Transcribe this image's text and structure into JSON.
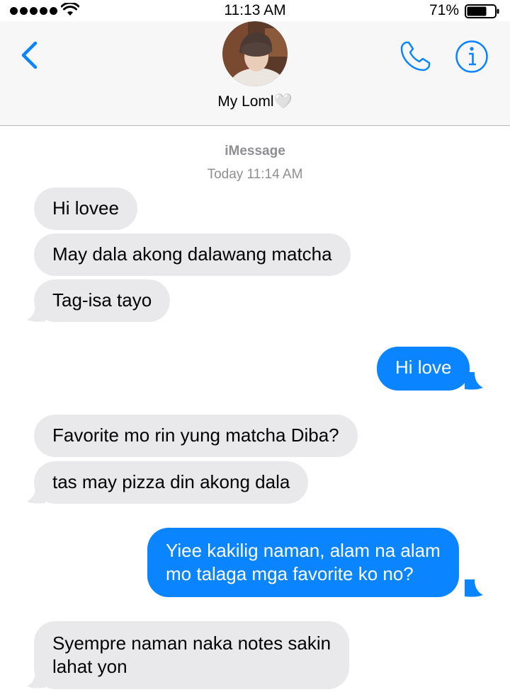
{
  "status_bar": {
    "time": "11:13 AM",
    "battery_percent": "71%",
    "battery_level": 0.71,
    "signal_bars": 5,
    "wifi_icon": "wifi-icon"
  },
  "header": {
    "contact_name": "My Loml🤍",
    "back_icon": "chevron-left-icon",
    "call_icon": "phone-icon",
    "info_icon": "info-icon",
    "accent_color": "#0a84ff"
  },
  "thread": {
    "service_label": "iMessage",
    "timestamp": "Today 11:14 AM",
    "messages": [
      {
        "direction": "incoming",
        "text": "Hi lovee"
      },
      {
        "direction": "incoming",
        "text": "May dala akong dalawang matcha"
      },
      {
        "direction": "incoming",
        "text": "Tag-isa tayo"
      },
      {
        "direction": "outgoing",
        "text": "Hi love"
      },
      {
        "direction": "incoming",
        "text": "Favorite mo rin yung matcha Diba?"
      },
      {
        "direction": "incoming",
        "text": "tas may pizza din akong dala"
      },
      {
        "direction": "outgoing",
        "text": [
          "Yiee kakilig naman, alam na alam",
          "mo talaga mga favorite ko no?"
        ]
      },
      {
        "direction": "incoming",
        "text": [
          "Syempre naman naka notes sakin",
          "lahat yon"
        ]
      }
    ],
    "incoming_color": "#e9e9eb",
    "outgoing_color": "#0a84ff"
  }
}
